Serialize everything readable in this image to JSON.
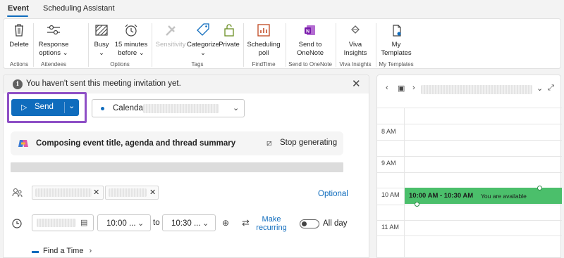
{
  "tabs": [
    {
      "label": "Event"
    },
    {
      "label": "Scheduling Assistant"
    }
  ],
  "ribbon": {
    "delete": "Delete",
    "response_options_1": "Response",
    "response_options_2": "options ⌄",
    "busy": "Busy",
    "reminder_1": "15 minutes",
    "reminder_2": "before ⌄",
    "sensitivity": "Sensitivity",
    "categorize": "Categorize",
    "private": "Private",
    "scheduling_poll_1": "Scheduling",
    "scheduling_poll_2": "poll",
    "send_onenote_1": "Send to",
    "send_onenote_2": "OneNote",
    "viva_1": "Viva",
    "viva_2": "Insights",
    "templates_1": "My",
    "templates_2": "Templates",
    "groups": {
      "actions": "Actions",
      "attendees": "Attendees",
      "options": "Options",
      "tags": "Tags",
      "findtime": "FindTime",
      "send_to_onenote": "Send to OneNote",
      "viva_insights": "Viva Insights",
      "my_templates": "My Templates"
    }
  },
  "compose": {
    "info_text": "You haven't sent this meeting invitation yet.",
    "send_label": "Send",
    "calendar_label": "Calendar",
    "copilot_text": "Composing event title, agenda and thread summary",
    "stop_label": "Stop generating",
    "optional_label": "Optional",
    "start_time": "10:00 ...",
    "to_label": "to",
    "end_time": "10:30 ...",
    "make_recurring": "Make recurring",
    "all_day": "All day",
    "find_time": "Find a Time"
  },
  "calendar": {
    "hours": [
      "8 AM",
      "9 AM",
      "10 AM",
      "11 AM"
    ],
    "event_time": "10:00 AM - 10:30 AM",
    "event_status": "You are available",
    "event_color": "#4bbf6b"
  },
  "colors": {
    "accent": "#0f6cbd",
    "highlight": "#8e4fc6"
  }
}
